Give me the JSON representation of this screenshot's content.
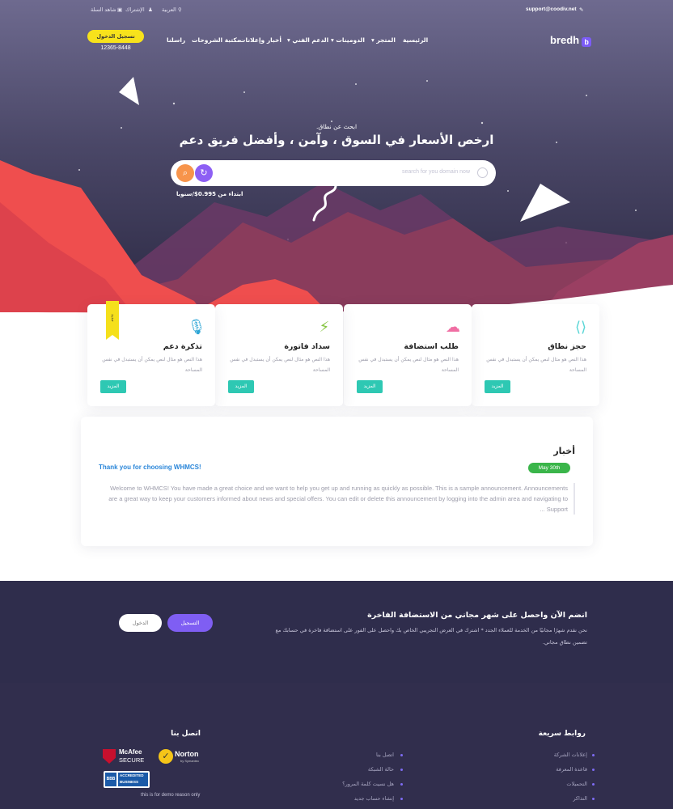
{
  "topbar": {
    "email": "support@coodiv.net",
    "language": "العربية",
    "subscribe": "الإشتراك",
    "view_cart": "شاهد السلة"
  },
  "nav": {
    "brand": "bredh",
    "brand_mark": "b",
    "items": [
      "الرئيسية",
      "المتجر",
      "الدومينات",
      "الدعم الفني",
      "أخبار وإعلانات",
      "مكتبة الشروحات",
      "راسلنا"
    ],
    "login_label": "تسجيل الدخول",
    "phone": "12365-8448"
  },
  "hero": {
    "subtitle": "ابحث عن نطاق.",
    "title": "ارخص الأسعار في السوق ، وآمن ، وأفضل فريق دعم",
    "search_placeholder": "search for you domain now",
    "price_note": "ابتداء من 0.995$/سنويا"
  },
  "services": [
    {
      "title": "حجز نطاق",
      "desc": "هذا النص هو مثال لنص يمكن أن يستبدل في نفس المساحة",
      "more": "المزيد",
      "icon": "share-icon",
      "color": "#5ad6d6"
    },
    {
      "title": "طلب استضافة",
      "desc": "هذا النص هو مثال لنص يمكن أن يستبدل في نفس المساحة",
      "more": "المزيد",
      "icon": "cloud-download-icon",
      "color": "#f06ea3"
    },
    {
      "title": "سداد فاتورة",
      "desc": "هذا النص هو مثال لنص يمكن أن يستبدل في نفس المساحة",
      "more": "المزيد",
      "icon": "lightning-icon",
      "color": "#84c43f"
    },
    {
      "title": "تذكرة دعم",
      "desc": "هذا النص هو مثال لنص يمكن أن يستبدل في نفس المساحة",
      "more": "المزيد",
      "icon": "microphone-icon",
      "color": "#2ea6d6",
      "ribbon": "جديد"
    }
  ],
  "news": {
    "heading": "أخبار",
    "date": "May 30th",
    "title": "Thank you for choosing WHMCS!",
    "body": "Welcome to WHMCS! You have made a great choice and we want to help you get up and running as quickly as possible. This is a sample announcement. Announcements are a great way to keep your customers informed about news and special offers. You can edit or delete this announcement by logging into the admin area and navigating to Support ..."
  },
  "cta": {
    "title": "انضم الآن واحصل على شهر مجاني من الاستضافة الفاخرة",
    "text": "نحن نقدم شهرًا مجانيًا من الخدمة للعملاء الجدد * اشترك في العرض التجريبي الخاص بك واحصل على الفور على استضافة فاخرة في حسابك مع تضمين نطاق مجاني.",
    "register": "التسجيل",
    "login": "الدخول"
  },
  "footer": {
    "quick_links_title": "روابط سريعة",
    "quick_links": [
      "إعلانات الشركة",
      "قاعدة المعرفة",
      "التحميلات",
      "التذاكر"
    ],
    "contact_title": "اتصل بنا",
    "contact_links": [
      "اتصل بنا",
      "حالة الشبكة",
      "هل نسيت كلمة المرور؟",
      "إنشاء حساب جديد"
    ],
    "badges": {
      "mcafee": "McAfee",
      "mcafee_sub": "SECURE",
      "norton": "Norton",
      "norton_sub": "by Symantec",
      "bbb": "BBB",
      "bbb_sub1": "ACCREDITED",
      "bbb_sub2": "BUSINESS"
    },
    "demo_note": "this is for demo reason only"
  },
  "colors": {
    "accent": "#7f5ef3",
    "yellow": "#f7e21c",
    "teal": "#2ec8b3",
    "dark": "#2f2d4c"
  }
}
